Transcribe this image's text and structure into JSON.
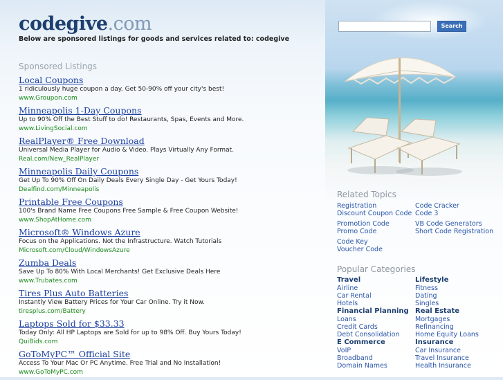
{
  "site": {
    "name_main": "codegive",
    "name_tld": ".com",
    "tagline": "Below are sponsored listings for goods and services related to: codegive"
  },
  "search": {
    "value": "",
    "button_label": "Search"
  },
  "sponsored_heading": "Sponsored Listings",
  "listings": [
    {
      "title": "Local Coupons",
      "desc": "1 ridiculously huge coupon a day. Get 50-90% off your city's best!",
      "url": "www.Groupon.com"
    },
    {
      "title": "Minneapolis 1-Day Coupons",
      "desc": "Up to 90% Off the Best Stuff to do! Restaurants, Spas, Events and More.",
      "url": "www.LivingSocial.com"
    },
    {
      "title": "RealPlayer® Free Download",
      "desc": "Universal Media Player for Audio & Video. Plays Virtually Any Format.",
      "url": "Real.com/New_RealPlayer"
    },
    {
      "title": "Minneapolis Daily Coupons",
      "desc": "Get Up To 90% Off On Daily Deals Every Single Day - Get Yours Today!",
      "url": "Dealfind.com/Minneapolis"
    },
    {
      "title": "Printable Free Coupons",
      "desc": "100's Brand Name Free Coupons Free Sample & Free Coupon Website!",
      "url": "www.ShopAtHome.com"
    },
    {
      "title": "Microsoft® Windows Azure",
      "desc": "Focus on the Applications. Not the Infrastructure. Watch Tutorials",
      "url": "Microsoft.com/Cloud/WindowsAzure"
    },
    {
      "title": "Zumba Deals",
      "desc": "Save Up To 80% With Local Merchants! Get Exclusive Deals Here",
      "url": "www.Trubates.com"
    },
    {
      "title": "Tires Plus Auto Batteries",
      "desc": "Instantly View Battery Prices for Your Car Online. Try it Now.",
      "url": "tiresplus.com/Battery"
    },
    {
      "title": "Laptops Sold for $33.33",
      "desc": "Today Only: All HP Laptops are Sold for up to 98% Off. Buy Yours Today!",
      "url": "QuiBids.com"
    },
    {
      "title": "GoToMyPC™ Official Site",
      "desc": "Access To Your Mac Or PC Anytime. Free Trial and No Installation!",
      "url": "www.GoToMyPC.com"
    }
  ],
  "related_heading": "Related Topics",
  "related": [
    "Registration",
    "Code Cracker",
    "Discount Coupon Code",
    "Code 3",
    "Promotion Code",
    "VB Code Generators",
    "Promo Code",
    "Short Code Registration",
    "Code Key",
    "Voucher Code"
  ],
  "popular_heading": "Popular Categories",
  "categories": [
    {
      "name": "Travel",
      "items": [
        "Airline",
        "Car Rental",
        "Hotels"
      ]
    },
    {
      "name": "Lifestyle",
      "items": [
        "Fitness",
        "Dating",
        "Singles"
      ]
    },
    {
      "name": "Financial Planning",
      "items": [
        "Loans",
        "Credit Cards",
        "Debt Consolidation"
      ]
    },
    {
      "name": "Real Estate",
      "items": [
        "Mortgages",
        "Refinancing",
        "Home Equity Loans"
      ]
    },
    {
      "name": "E Commerce",
      "items": [
        "VoIP",
        "Broadband",
        "Domain Names"
      ]
    },
    {
      "name": "Insurance",
      "items": [
        "Car Insurance",
        "Travel Insurance",
        "Health Insurance"
      ]
    }
  ]
}
